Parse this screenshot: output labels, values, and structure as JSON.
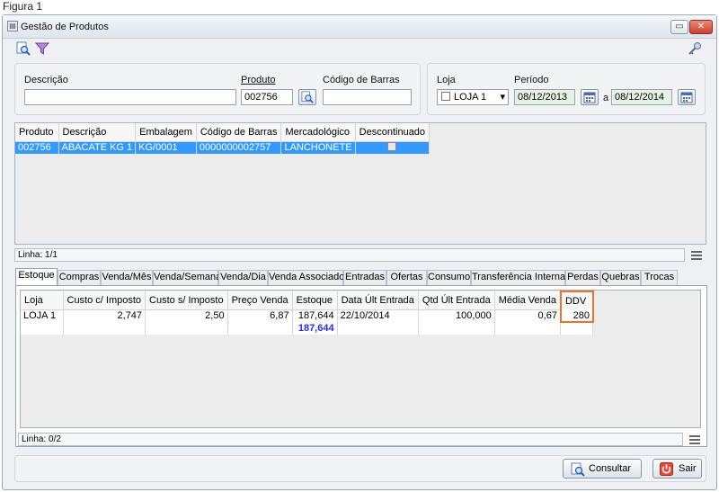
{
  "figure_caption": "Figura 1",
  "window": {
    "title": "Gestão de Produtos",
    "restore_glyph": "▭",
    "close_glyph": "✕"
  },
  "toolbar": {
    "icons": [
      "search-doc-icon",
      "filter-icon",
      "key-icon"
    ]
  },
  "filters": {
    "descricao_label": "Descrição",
    "descricao_value": "",
    "produto_label": "Produto",
    "produto_value": "002756",
    "codigo_barras_label": "Código de Barras",
    "codigo_barras_value": "",
    "loja_label": "Loja",
    "loja_value": "LOJA 1",
    "periodo_label": "Período",
    "periodo_from": "08/12/2013",
    "periodo_sep": "a",
    "periodo_to": "08/12/2014"
  },
  "products_grid": {
    "columns": [
      "Produto",
      "Descrição",
      "Embalagem",
      "Código de Barras",
      "Mercadológico",
      "Descontinuado"
    ],
    "rows": [
      {
        "produto": "002756",
        "descricao": "ABACATE KG 1",
        "embalagem": "KG/0001",
        "codigo_barras": "0000000002757",
        "mercadologico": "LANCHONETE",
        "descontinuado": false
      }
    ],
    "status": "Linha: 1/1"
  },
  "tabs": [
    "Estoque",
    "Compras",
    "Venda/Mês",
    "Venda/Semana",
    "Venda/Dia",
    "Venda Associado",
    "Entradas",
    "Ofertas",
    "Consumo",
    "Transferência Interna",
    "Perdas",
    "Quebras",
    "Trocas"
  ],
  "active_tab": "Estoque",
  "stock_grid": {
    "columns": [
      "Loja",
      "Custo c/ Imposto",
      "Custo s/ Imposto",
      "Preço Venda",
      "Estoque",
      "Data Últ Entrada",
      "Qtd Últ Entrada",
      "Média Venda",
      "DDV"
    ],
    "rows": [
      {
        "loja": "LOJA 1",
        "custo_c": "2,747",
        "custo_s": "2,50",
        "preco": "6,87",
        "estoque": "187,644",
        "data": "22/10/2014",
        "qtd": "100,000",
        "media": "0,67",
        "ddv": "280"
      }
    ],
    "total_estoque": "187,644",
    "status": "Linha: 0/2",
    "highlight_color": "#e8742a",
    "total_color": "#2b2bd6"
  },
  "buttons": {
    "consultar": "Consultar",
    "sair": "Sair"
  },
  "colors": {
    "selection": "#3399ff"
  }
}
